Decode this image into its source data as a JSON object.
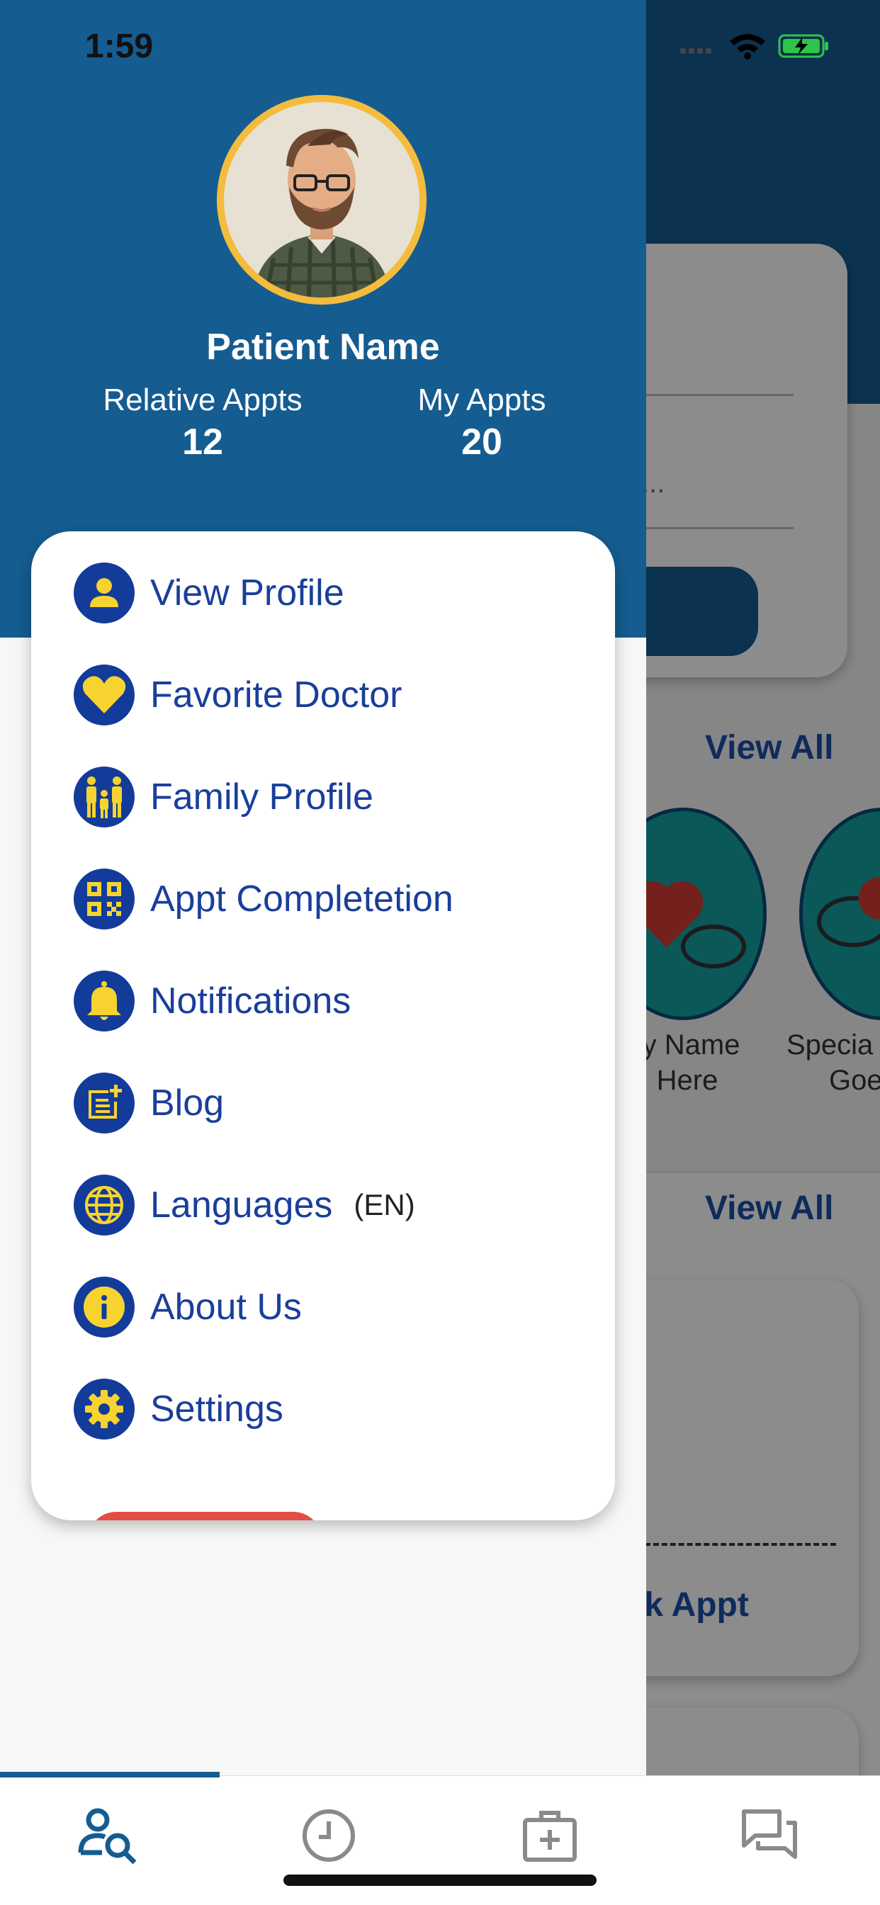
{
  "status_bar": {
    "time": "1:59"
  },
  "drawer": {
    "patient_name": "Patient Name",
    "relative_appts_label": "Relative Appts",
    "relative_appts_count": "12",
    "my_appts_label": "My Appts",
    "my_appts_count": "20",
    "menu": [
      {
        "label": "View Profile",
        "icon": "person-icon"
      },
      {
        "label": "Favorite Doctor",
        "icon": "heart-icon"
      },
      {
        "label": "Family Profile",
        "icon": "family-icon"
      },
      {
        "label": "Appt Completetion",
        "icon": "qr-code-icon"
      },
      {
        "label": "Notifications",
        "icon": "bell-icon"
      },
      {
        "label": " Blog",
        "icon": "blog-icon"
      },
      {
        "label": "Languages",
        "icon": "globe-icon",
        "sub": "(EN)"
      },
      {
        "label": "About Us",
        "icon": "info-icon"
      },
      {
        "label": "Settings",
        "icon": "gear-icon"
      }
    ]
  },
  "background": {
    "view_all_1": "View All",
    "view_all_2": "View All",
    "specialty_1_line1": "ty Name",
    "specialty_1_line2": "Here",
    "specialty_2_line1": "Specia",
    "specialty_2_line2": "Goe",
    "book_label": "ok Appt",
    "field_dots": "..."
  },
  "bottom_nav": [
    {
      "icon": "doctor-search-icon",
      "active": true
    },
    {
      "icon": "clock-icon"
    },
    {
      "icon": "medical-kit-icon"
    },
    {
      "icon": "chat-icon"
    }
  ],
  "colors": {
    "primary": "#155c91",
    "menu_text": "#1a3f9a",
    "icon_bg": "#123b9a",
    "icon_fg": "#f7d330",
    "avatar_ring": "#f3bc3c",
    "logout": "#e34d45"
  }
}
